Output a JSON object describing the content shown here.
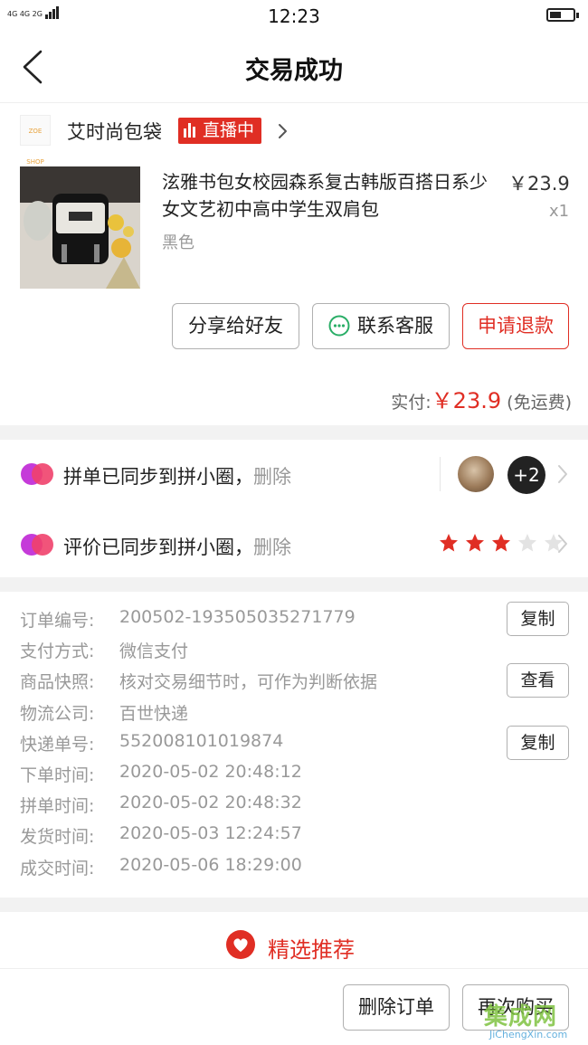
{
  "status_bar": {
    "network": "4G 4G 2G",
    "time": "12:23"
  },
  "nav": {
    "title": "交易成功"
  },
  "shop": {
    "name": "艾时尚包袋",
    "live_badge": "直播中",
    "logo_text": "ZOE SHOP"
  },
  "product": {
    "title": "泫雅书包女校园森系复古韩版百搭日系少女文艺初中高中学生双肩包",
    "price": "￥23.9",
    "quantity": "x1",
    "spec": "黑色"
  },
  "actions": {
    "share": "分享给好友",
    "contact": "联系客服",
    "refund": "申请退款"
  },
  "payment": {
    "paid_label": "实付:",
    "paid_amount": "￥23.9",
    "shipping_note": "(免运费)"
  },
  "sync": {
    "group_text": "拼单已同步到拼小圈，",
    "review_text": "评价已同步到拼小圈，",
    "delete_label": "删除",
    "more_count": "+2",
    "rating": 3,
    "rating_max": 5
  },
  "details": {
    "rows": [
      {
        "label": "订单编号:",
        "value": "200502-193505035271779",
        "button": "复制"
      },
      {
        "label": "支付方式:",
        "value": "微信支付"
      },
      {
        "label": "商品快照:",
        "value": "核对交易细节时，可作为判断依据",
        "button": "查看"
      },
      {
        "label": "物流公司:",
        "value": "百世快递"
      },
      {
        "label": "快递单号:",
        "value": "552008101019874",
        "button": "复制"
      },
      {
        "label": "下单时间:",
        "value": "2020-05-02 20:48:12"
      },
      {
        "label": "拼单时间:",
        "value": "2020-05-02 20:48:32"
      },
      {
        "label": "发货时间:",
        "value": "2020-05-03 12:24:57"
      },
      {
        "label": "成交时间:",
        "value": "2020-05-06 18:29:00"
      }
    ]
  },
  "recommend": {
    "title": "精选推荐"
  },
  "bottom": {
    "delete_order": "删除订单",
    "buy_again": "再次购买"
  },
  "watermark": {
    "cn": "集成网",
    "en": "JiChengXin.com"
  },
  "colors": {
    "accent": "#e02e24",
    "muted": "#999999",
    "gap": "#f2f2f2"
  }
}
